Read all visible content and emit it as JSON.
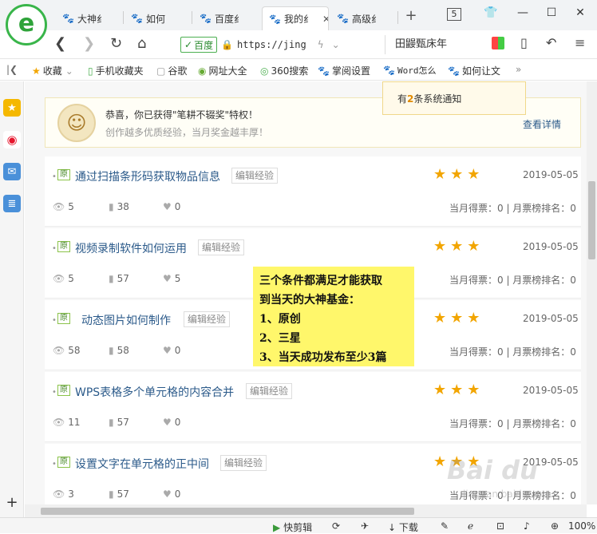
{
  "browser": {
    "logo_letter": "e",
    "tabs": [
      {
        "label": "大神纟"
      },
      {
        "label": "如何"
      },
      {
        "label": "百度纟"
      },
      {
        "label": "我的纟",
        "active": true
      },
      {
        "label": "高级纟"
      }
    ],
    "new_tab": "+",
    "tab_count": "5",
    "address": {
      "site_tag": "百度",
      "url": "https://jing"
    },
    "search_text": "田鼹甄床年",
    "bookmarks": [
      "收藏",
      "手机收藏夹",
      "谷歌",
      "网址大全",
      "360搜索",
      "掌阅设置",
      "Word怎么",
      "如何让文"
    ],
    "more": "»"
  },
  "notice": {
    "prefix": "有",
    "count": "2",
    "suffix": "条系统通知"
  },
  "banner": {
    "headline": "恭喜，你已获得\"笔耕不辍奖\"特权！",
    "subline": "创作越多优质经验，当月奖金越丰厚！",
    "details_link": "查看详情"
  },
  "edit_label": "编辑经验",
  "original_badge": "原",
  "stars": "★★★",
  "rows": [
    {
      "title": "通过扫描条形码获取物品信息",
      "date": "2019-05-05",
      "views": "5",
      "votes": "38",
      "likes": "0",
      "rank": "当月得票：0 | 月票榜排名：0"
    },
    {
      "title": "视频录制软件如何运用",
      "date": "2019-05-05",
      "views": "5",
      "votes": "57",
      "likes": "5",
      "rank": "当月得票：0 | 月票榜排名：0"
    },
    {
      "title": "动态图片如何制作",
      "date": "2019-05-05",
      "views": "58",
      "votes": "58",
      "likes": "0",
      "rank": "当月得票：0 | 月票榜排名：0"
    },
    {
      "title": "WPS表格多个单元格的内容合并",
      "date": "2019-05-05",
      "views": "11",
      "votes": "57",
      "likes": "0",
      "rank": "当月得票：0 | 月票榜排名：0"
    },
    {
      "title": "设置文字在单元格的正中间",
      "date": "2019-05-05",
      "views": "3",
      "votes": "57",
      "likes": "0",
      "rank": "当月得票：0 | 月票榜排名：0"
    }
  ],
  "callout": {
    "line1": "三个条件都满足才能获取",
    "line2": "到当天的大神基金：",
    "line3": "1、原创",
    "line4": "2、三星",
    "line5": "3、当天成功发布至少3篇"
  },
  "status": {
    "clip": "快剪辑",
    "download": "下载",
    "zoom": "100%"
  },
  "watermark": "Bai du",
  "watermark_sub": "jingyan.baidu.com"
}
